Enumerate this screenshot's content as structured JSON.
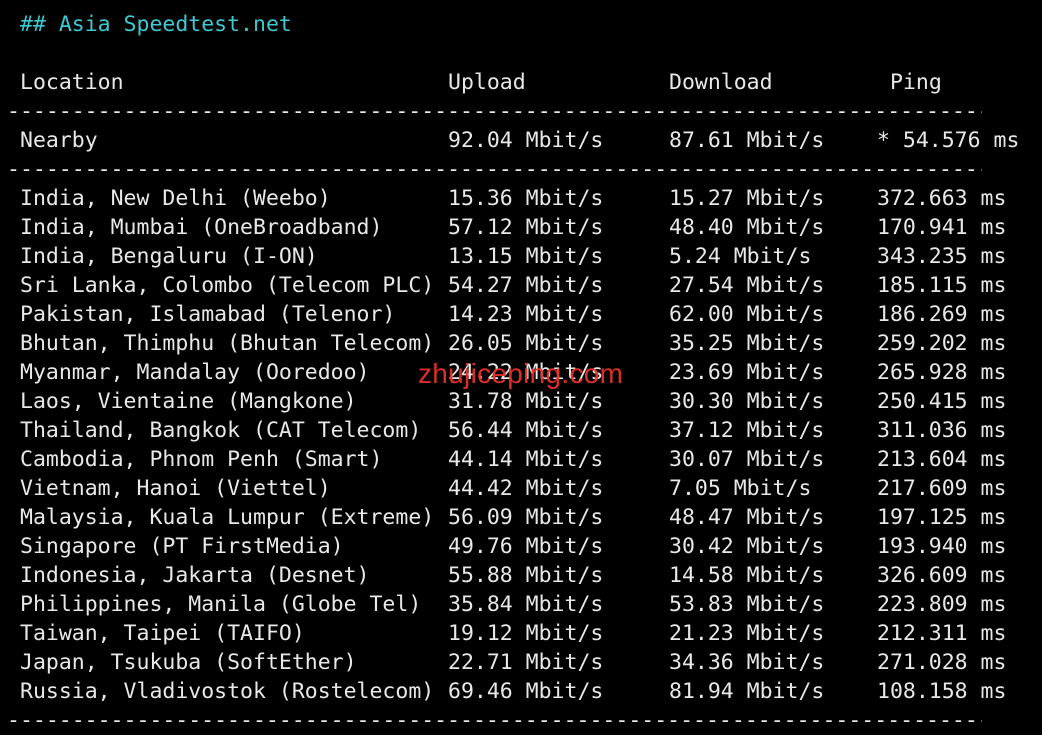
{
  "terminal": {
    "heading": "## Asia Speedtest.net",
    "columns": {
      "location": "Location",
      "upload": "Upload",
      "download": "Download",
      "ping": "Ping"
    },
    "separator": "----------------------------------------------------------------------------",
    "nearby": {
      "location": "Nearby",
      "upload": "92.04 Mbit/s",
      "download": "87.61 Mbit/s",
      "ping": "* 54.576 ms"
    },
    "rows": [
      {
        "location": "India, New Delhi (Weebo)",
        "upload": "15.36 Mbit/s",
        "download": "15.27 Mbit/s",
        "ping": "372.663 ms"
      },
      {
        "location": "India, Mumbai (OneBroadband)",
        "upload": "57.12 Mbit/s",
        "download": "48.40 Mbit/s",
        "ping": "170.941 ms"
      },
      {
        "location": "India, Bengaluru (I-ON)",
        "upload": "13.15 Mbit/s",
        "download": "5.24 Mbit/s",
        "ping": "343.235 ms"
      },
      {
        "location": "Sri Lanka, Colombo (Telecom PLC)",
        "upload": "54.27 Mbit/s",
        "download": "27.54 Mbit/s",
        "ping": "185.115 ms"
      },
      {
        "location": "Pakistan, Islamabad (Telenor)",
        "upload": "14.23 Mbit/s",
        "download": "62.00 Mbit/s",
        "ping": "186.269 ms"
      },
      {
        "location": "Bhutan, Thimphu (Bhutan Telecom)",
        "upload": "26.05 Mbit/s",
        "download": "35.25 Mbit/s",
        "ping": "259.202 ms"
      },
      {
        "location": "Myanmar, Mandalay (Ooredoo)",
        "upload": "24.22 Mbit/s",
        "download": "23.69 Mbit/s",
        "ping": "265.928 ms"
      },
      {
        "location": "Laos, Vientaine (Mangkone)",
        "upload": "31.78 Mbit/s",
        "download": "30.30 Mbit/s",
        "ping": "250.415 ms"
      },
      {
        "location": "Thailand, Bangkok (CAT Telecom)",
        "upload": "56.44 Mbit/s",
        "download": "37.12 Mbit/s",
        "ping": "311.036 ms"
      },
      {
        "location": "Cambodia, Phnom Penh (Smart)",
        "upload": "44.14 Mbit/s",
        "download": "30.07 Mbit/s",
        "ping": "213.604 ms"
      },
      {
        "location": "Vietnam, Hanoi (Viettel)",
        "upload": "44.42 Mbit/s",
        "download": "7.05 Mbit/s",
        "ping": "217.609 ms"
      },
      {
        "location": "Malaysia, Kuala Lumpur (Extreme)",
        "upload": "56.09 Mbit/s",
        "download": "48.47 Mbit/s",
        "ping": "197.125 ms"
      },
      {
        "location": "Singapore (PT FirstMedia)",
        "upload": "49.76 Mbit/s",
        "download": "30.42 Mbit/s",
        "ping": "193.940 ms"
      },
      {
        "location": "Indonesia, Jakarta (Desnet)",
        "upload": "55.88 Mbit/s",
        "download": "14.58 Mbit/s",
        "ping": "326.609 ms"
      },
      {
        "location": "Philippines, Manila (Globe Tel)",
        "upload": "35.84 Mbit/s",
        "download": "53.83 Mbit/s",
        "ping": "223.809 ms"
      },
      {
        "location": "Taiwan, Taipei (TAIFO)",
        "upload": "19.12 Mbit/s",
        "download": "21.23 Mbit/s",
        "ping": "212.311 ms"
      },
      {
        "location": "Japan, Tsukuba (SoftEther)",
        "upload": "22.71 Mbit/s",
        "download": "34.36 Mbit/s",
        "ping": "271.028 ms"
      },
      {
        "location": "Russia, Vladivostok (Rostelecom)",
        "upload": "69.46 Mbit/s",
        "download": "81.94 Mbit/s",
        "ping": "108.158 ms"
      }
    ],
    "watermark": "zhujiceping.com"
  },
  "colors": {
    "background": "#000000",
    "text": "#e8e8e8",
    "heading": "#3ec8d2",
    "watermark": "#e8312a"
  }
}
